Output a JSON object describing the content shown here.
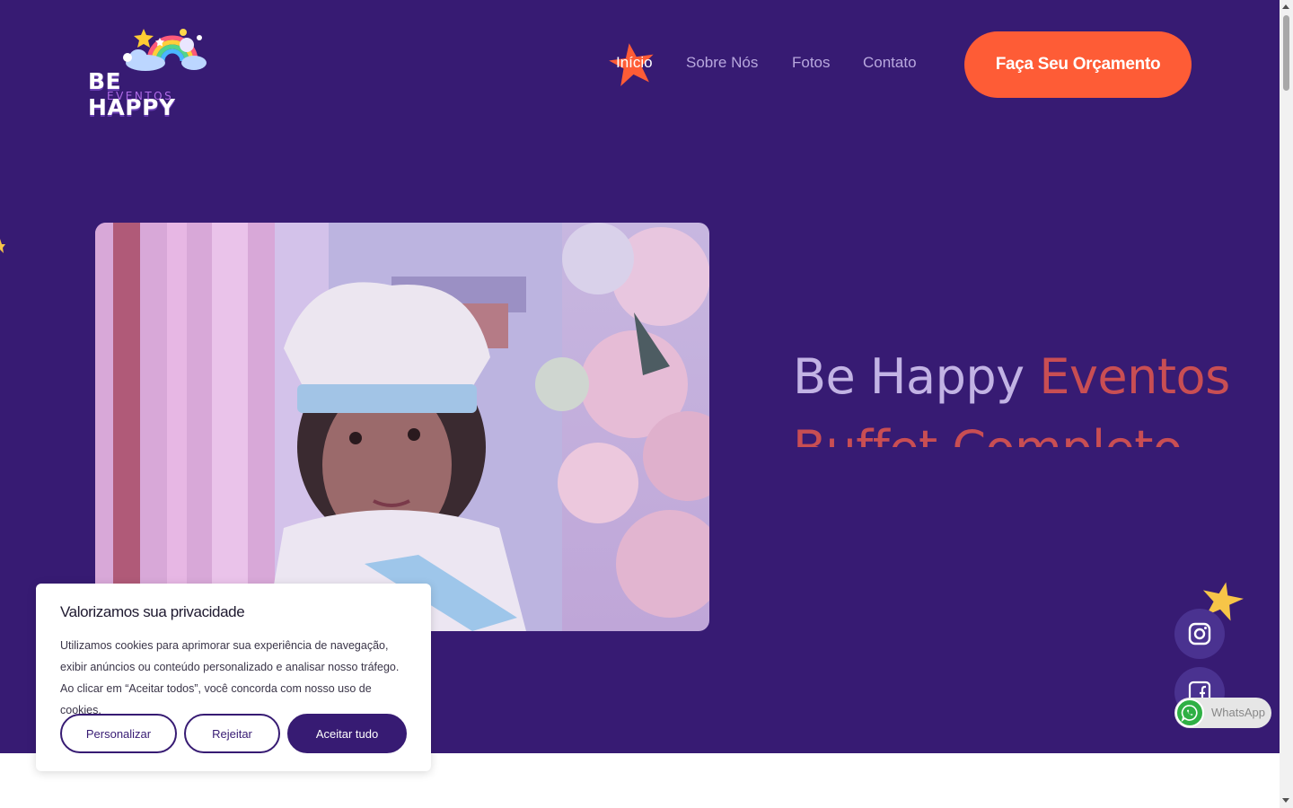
{
  "brand": {
    "logo_line1": "BE HAPPY",
    "logo_line2": "EVENTOS"
  },
  "nav": {
    "items": [
      {
        "label": "Início",
        "active": true
      },
      {
        "label": "Sobre Nós",
        "active": false
      },
      {
        "label": "Fotos",
        "active": false
      },
      {
        "label": "Contato",
        "active": false
      }
    ],
    "cta_label": "Faça Seu Orçamento"
  },
  "hero": {
    "title_part1": "Be Happy",
    "title_part2": "Eventos",
    "subtitle": "Buffet Completo"
  },
  "cookie": {
    "title": "Valorizamos sua privacidade",
    "text": "Utilizamos cookies para aprimorar sua experiência de navegação, exibir anúncios ou conteúdo personalizado e analisar nosso tráfego. Ao clicar em “Aceitar todos”, você concorda com nosso uso de cookies.",
    "customize_label": "Personalizar",
    "reject_label": "Rejeitar",
    "accept_label": "Aceitar tudo"
  },
  "social": {
    "instagram_icon": "instagram-icon",
    "facebook_icon": "facebook-icon",
    "whatsapp_label": "WhatsApp"
  },
  "colors": {
    "hero_bg": "#371b73",
    "accent": "#fe5c36",
    "title_light": "#c2b3e4",
    "title_accent": "#c94e53",
    "whatsapp_green": "#2fb044"
  }
}
